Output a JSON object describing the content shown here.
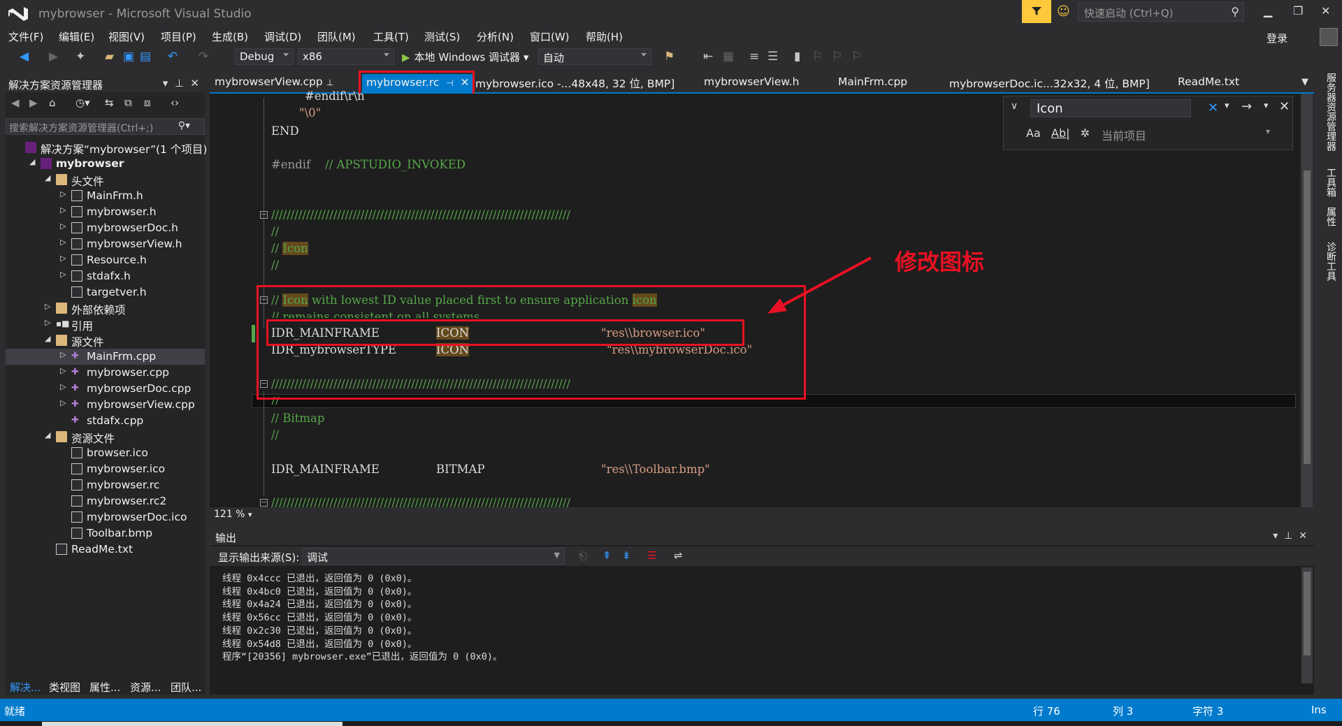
{
  "window": {
    "title": "mybrowser - Microsoft Visual Studio",
    "quick_launch_placeholder": "快速启动 (Ctrl+Q)",
    "login": "登录"
  },
  "menu": [
    "文件(F)",
    "编辑(E)",
    "视图(V)",
    "项目(P)",
    "生成(B)",
    "调试(D)",
    "团队(M)",
    "工具(T)",
    "测试(S)",
    "分析(N)",
    "窗口(W)",
    "帮助(H)"
  ],
  "toolbar": {
    "config": "Debug",
    "platform": "x86",
    "run_label": "本地 Windows 调试器",
    "run_mode": "自动"
  },
  "solution_explorer": {
    "title": "解决方案资源管理器",
    "search_placeholder": "搜索解决方案资源管理器(Ctrl+;)",
    "tree": [
      {
        "label": "解决方案“mybrowser”(1 个项目)",
        "indent": 0,
        "type": "sln",
        "expander": ""
      },
      {
        "label": "mybrowser",
        "indent": 1,
        "type": "proj",
        "expander": "◢"
      },
      {
        "label": "头文件",
        "indent": 2,
        "type": "folder",
        "expander": "◢"
      },
      {
        "label": "MainFrm.h",
        "indent": 3,
        "type": "file",
        "expander": "▷"
      },
      {
        "label": "mybrowser.h",
        "indent": 3,
        "type": "file",
        "expander": "▷"
      },
      {
        "label": "mybrowserDoc.h",
        "indent": 3,
        "type": "file",
        "expander": "▷"
      },
      {
        "label": "mybrowserView.h",
        "indent": 3,
        "type": "file",
        "expander": "▷"
      },
      {
        "label": "Resource.h",
        "indent": 3,
        "type": "file",
        "expander": "▷"
      },
      {
        "label": "stdafx.h",
        "indent": 3,
        "type": "file",
        "expander": "▷"
      },
      {
        "label": "targetver.h",
        "indent": 3,
        "type": "file",
        "expander": ""
      },
      {
        "label": "外部依赖项",
        "indent": 2,
        "type": "folder",
        "expander": "▷"
      },
      {
        "label": "引用",
        "indent": 2,
        "type": "ref",
        "expander": "▷"
      },
      {
        "label": "源文件",
        "indent": 2,
        "type": "folder",
        "expander": "◢"
      },
      {
        "label": "MainFrm.cpp",
        "indent": 3,
        "type": "cpp",
        "expander": "▷",
        "selected": true
      },
      {
        "label": "mybrowser.cpp",
        "indent": 3,
        "type": "cpp",
        "expander": "▷"
      },
      {
        "label": "mybrowserDoc.cpp",
        "indent": 3,
        "type": "cpp",
        "expander": "▷"
      },
      {
        "label": "mybrowserView.cpp",
        "indent": 3,
        "type": "cpp",
        "expander": "▷"
      },
      {
        "label": "stdafx.cpp",
        "indent": 3,
        "type": "cpp",
        "expander": ""
      },
      {
        "label": "资源文件",
        "indent": 2,
        "type": "folder",
        "expander": "◢"
      },
      {
        "label": "browser.ico",
        "indent": 3,
        "type": "file",
        "expander": ""
      },
      {
        "label": "mybrowser.ico",
        "indent": 3,
        "type": "file",
        "expander": ""
      },
      {
        "label": "mybrowser.rc",
        "indent": 3,
        "type": "file",
        "expander": ""
      },
      {
        "label": "mybrowser.rc2",
        "indent": 3,
        "type": "file",
        "expander": ""
      },
      {
        "label": "mybrowserDoc.ico",
        "indent": 3,
        "type": "file",
        "expander": ""
      },
      {
        "label": "Toolbar.bmp",
        "indent": 3,
        "type": "file",
        "expander": ""
      },
      {
        "label": "ReadMe.txt",
        "indent": 2,
        "type": "file",
        "expander": ""
      }
    ],
    "bottom_tabs": [
      "解决...",
      "类视图",
      "属性...",
      "资源...",
      "团队..."
    ]
  },
  "doc_tabs": [
    "mybrowserView.cpp",
    "mybrowser.rc",
    "mybrowser.ico -...48x48, 32 位, BMP]",
    "mybrowserView.h",
    "MainFrm.cpp",
    "mybrowserDoc.ic...32x32, 4 位, BMP]",
    "ReadMe.txt"
  ],
  "find": {
    "query": "Icon",
    "scope": "当前项目",
    "opt_case": "Aa",
    "opt_word": "Ab|"
  },
  "code": {
    "l1": "#endif\\r\\n",
    "l2": "\"\\0\"",
    "l3": "END",
    "l4_kw": "#endif",
    "l4_cm": "// APSTUDIO_INVOKED",
    "sep": "/////////////////////////////////////////////////////////////////////////////",
    "slashes": "//",
    "icon_word": "Icon",
    "cm_prefix": "// ",
    "cm_mid": " with lowest ID value placed first to ensure application ",
    "cm_icon2": "icon",
    "cm_line2": "// remains consistent on all systems",
    "r1_id": "IDR_MAINFRAME",
    "r1_type": "ICON",
    "r1_file": "\"res\\\\browser.ico\"",
    "r2_id": "IDR_mybrowserTYPE",
    "r2_type": "ICON",
    "r2_file": "\"res\\\\mybrowserDoc.ico\"",
    "bitmap_cm": "// Bitmap",
    "r3_id": "IDR_MAINFRAME",
    "r3_type": "BITMAP",
    "r3_file": "\"res\\\\Toolbar.bmp\""
  },
  "annotation": "修改图标",
  "zoom": "121 %",
  "output": {
    "title": "输出",
    "source_label": "显示输出来源(S):",
    "source_value": "调试",
    "lines": [
      "线程 0x4ccc 已退出，返回值为 0 (0x0)。",
      "线程 0x4bc0 已退出，返回值为 0 (0x0)。",
      "线程 0x4a24 已退出，返回值为 0 (0x0)。",
      "线程 0x56cc 已退出，返回值为 0 (0x0)。",
      "线程 0x2c30 已退出，返回值为 0 (0x0)。",
      "线程 0x54d8 已退出，返回值为 0 (0x0)。",
      "程序“[20356] mybrowser.exe”已退出，返回值为 0 (0x0)。"
    ]
  },
  "right_panels": [
    "服务器资源管理器",
    "工具箱",
    "属性",
    "诊断工具"
  ],
  "status": {
    "ready": "就绪",
    "row": "行 76",
    "col": "列 3",
    "ch": "字符 3",
    "ins": "Ins"
  },
  "colors": {
    "accent": "#007acc",
    "annotation": "#e81123"
  }
}
